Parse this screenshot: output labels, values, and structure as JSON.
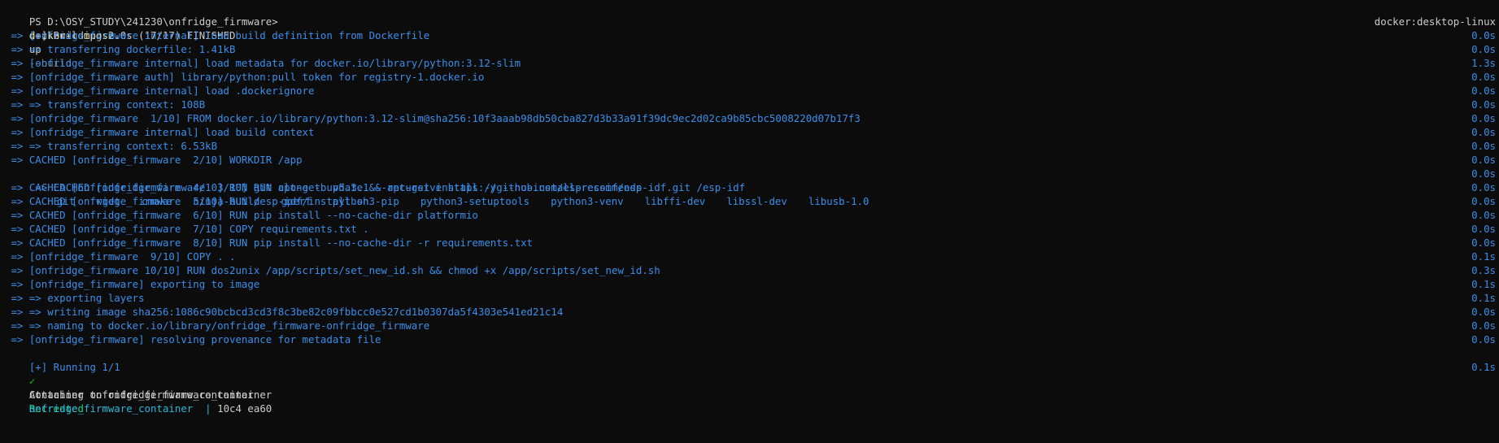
{
  "prompt": {
    "path": "PS D:\\OSY_STUDY\\241230\\onfridge_firmware>",
    "command": "docker-compose",
    "args": "up",
    "flag": "--build"
  },
  "building": {
    "text": "[+] Building 2.0s (17/17) FINISHED",
    "context": "docker:desktop-linux"
  },
  "steps": [
    {
      "text": " => [onfridge_firmware internal] load build definition from Dockerfile",
      "time": "0.0s"
    },
    {
      "text": " => => transferring dockerfile: 1.41kB",
      "time": "0.0s"
    },
    {
      "text": " => [onfridge_firmware internal] load metadata for docker.io/library/python:3.12-slim",
      "time": "1.3s"
    },
    {
      "text": " => [onfridge_firmware auth] library/python:pull token for registry-1.docker.io",
      "time": "0.0s"
    },
    {
      "text": " => [onfridge_firmware internal] load .dockerignore",
      "time": "0.0s"
    },
    {
      "text": " => => transferring context: 108B",
      "time": "0.0s"
    },
    {
      "text": " => [onfridge_firmware  1/10] FROM docker.io/library/python:3.12-slim@sha256:10f3aaab98db50cba827d3b33a91f39dc9ec2d02ca9b85cbc5008220d07b17f3",
      "time": "0.0s"
    },
    {
      "text": " => [onfridge_firmware internal] load build context",
      "time": "0.0s"
    },
    {
      "text": " => => transferring context: 6.53kB",
      "time": "0.0s"
    },
    {
      "text": " => CACHED [onfridge_firmware  2/10] WORKDIR /app",
      "time": "0.0s"
    }
  ],
  "apt_step": {
    "prefix": " => CACHED [onfridge_firmware  3/10] RUN apt-get update && apt-get install -y --no-install-recommends",
    "packages": [
      "git",
      "wget",
      "cmake",
      "ninja-build",
      "gperf",
      "python3-pip",
      "python3-setuptools",
      "python3-venv",
      "libffi-dev",
      "libssl-dev",
      "libusb-1.0"
    ],
    "time": "0.0s"
  },
  "steps2": [
    {
      "text": " => CACHED [onfridge_firmware  4/10] RUN git clone -b v5.3.1 --recursive https://github.com/espressif/esp-idf.git /esp-idf",
      "time": "0.0s"
    },
    {
      "text": " => CACHED [onfridge_firmware  5/10] RUN /esp-idf/install.sh",
      "time": "0.0s"
    },
    {
      "text": " => CACHED [onfridge_firmware  6/10] RUN pip install --no-cache-dir platformio",
      "time": "0.0s"
    },
    {
      "text": " => CACHED [onfridge_firmware  7/10] COPY requirements.txt .",
      "time": "0.0s"
    },
    {
      "text": " => CACHED [onfridge_firmware  8/10] RUN pip install --no-cache-dir -r requirements.txt",
      "time": "0.0s"
    },
    {
      "text": " => [onfridge_firmware  9/10] COPY . .",
      "time": "0.1s"
    },
    {
      "text": " => [onfridge_firmware 10/10] RUN dos2unix /app/scripts/set_new_id.sh && chmod +x /app/scripts/set_new_id.sh",
      "time": "0.3s"
    },
    {
      "text": " => [onfridge_firmware] exporting to image",
      "time": "0.1s"
    },
    {
      "text": " => => exporting layers",
      "time": "0.1s"
    },
    {
      "text": " => => writing image sha256:1086c90bcbcd3cd3f8c3be82c09fbbcc0e527cd1b0307da5f4303e541ed21c14",
      "time": "0.0s"
    },
    {
      "text": " => => naming to docker.io/library/onfridge_firmware-onfridge_firmware",
      "time": "0.0s"
    },
    {
      "text": " => [onfridge_firmware] resolving provenance for metadata file",
      "time": "0.0s"
    }
  ],
  "running": {
    "text": "[+] Running 1/1"
  },
  "container": {
    "check": "✓",
    "label": "Container onfridge_firmware_container",
    "status": "Recreated",
    "time": "0.1s"
  },
  "attaching": {
    "text": "Attaching to onfridge_firmware_container"
  },
  "log": {
    "name": "onfridge_firmware_container",
    "sep": "  | ",
    "text": "10c4 ea60"
  },
  "colors": {
    "background": "#0c0c0c",
    "text": "#cccccc",
    "blue": "#3b8eea",
    "yellow": "#f9f1a5",
    "green": "#16c60c",
    "status_green": "#23d18b"
  }
}
